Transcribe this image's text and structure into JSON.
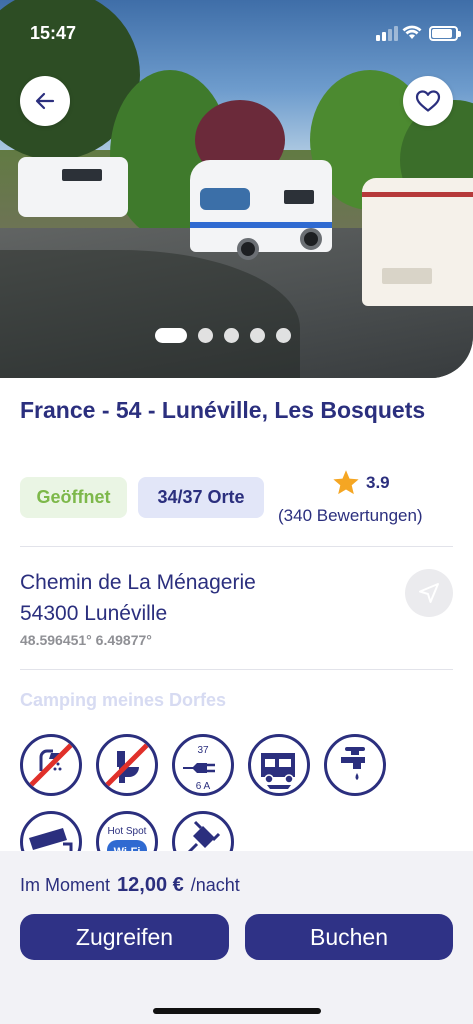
{
  "status_bar": {
    "time": "15:47"
  },
  "gallery": {
    "image_count": 5,
    "active_index": 0
  },
  "listing": {
    "title": "France - 54 - Lunéville, Les Bosquets",
    "status_badge": "Geöffnet",
    "places_badge": "34/37 Orte",
    "rating": "3.9",
    "reviews": "(340 Bewertungen)",
    "address_line1": "Chemin de La Ménagerie",
    "address_line2": "54300 Lunéville",
    "coordinates": "48.596451° 6.49877°",
    "section_title": "Camping meines Dorfes",
    "amenities": [
      {
        "name": "no-shower",
        "icon": "shower-crossed-icon"
      },
      {
        "name": "no-toilet",
        "icon": "toilet-crossed-icon"
      },
      {
        "name": "electricity",
        "icon": "plug-icon",
        "top_label": "37",
        "bottom_label": "6 A"
      },
      {
        "name": "motorhome-service",
        "icon": "camper-icon"
      },
      {
        "name": "water-tap",
        "icon": "tap-icon"
      },
      {
        "name": "cctv",
        "icon": "camera-icon"
      },
      {
        "name": "wifi-hotspot",
        "icon": "wifi-hotspot-icon",
        "label": "Hot Spot",
        "sub_label": "Wi-Fi"
      },
      {
        "name": "electric-plug",
        "icon": "plug-icon"
      }
    ]
  },
  "footer": {
    "price_prefix": "Im Moment",
    "price_value": "12,00 €",
    "price_unit": "/nacht",
    "grab_label": "Zugreifen",
    "book_label": "Buchen"
  },
  "colors": {
    "brand": "#2f3286",
    "text": "#2b2f7e",
    "open_green": "#7db84a",
    "star": "#f5a623",
    "cross_red": "#e0302a"
  }
}
